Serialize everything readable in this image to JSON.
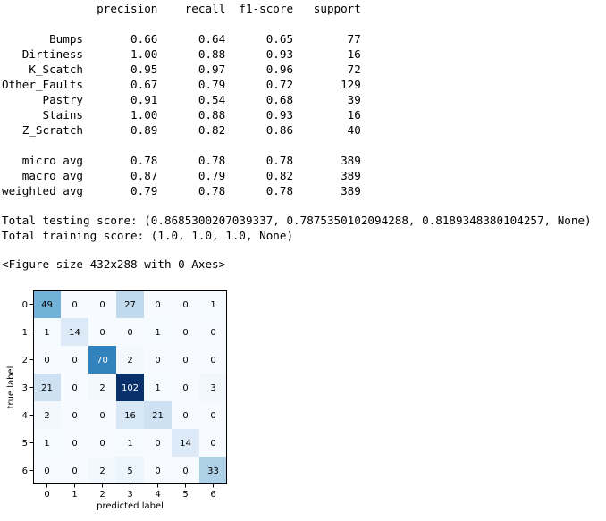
{
  "report": {
    "header": "              precision    recall  f1-score   support",
    "rows": [
      "",
      "       Bumps       0.66      0.64      0.65        77",
      "   Dirtiness       1.00      0.88      0.93        16",
      "    K_Scatch       0.95      0.97      0.96        72",
      "Other_Faults       0.67      0.79      0.72       129",
      "      Pastry       0.91      0.54      0.68        39",
      "      Stains       1.00      0.88      0.93        16",
      "   Z_Scratch       0.89      0.82      0.86        40",
      "",
      "   micro avg       0.78      0.78      0.78       389",
      "   macro avg       0.87      0.79      0.82       389",
      "weighted avg       0.79      0.78      0.78       389"
    ]
  },
  "scores": {
    "testing": "Total testing score: (0.8685300207039337, 0.7875350102094288, 0.8189348380104257, None)",
    "training": "Total training score: (1.0, 1.0, 1.0, None)"
  },
  "figure_size": "<Figure size 432x288 with 0 Axes>",
  "chart_data": {
    "type": "heatmap",
    "xlabel": "predicted label",
    "ylabel": "true label",
    "x_ticks": [
      "0",
      "1",
      "2",
      "3",
      "4",
      "5",
      "6"
    ],
    "y_ticks": [
      "0",
      "1",
      "2",
      "3",
      "4",
      "5",
      "6"
    ],
    "colormap": "Blues",
    "vmin": 0,
    "vmax": 102,
    "matrix": [
      [
        49,
        0,
        0,
        27,
        0,
        0,
        1
      ],
      [
        1,
        14,
        0,
        0,
        1,
        0,
        0
      ],
      [
        0,
        0,
        70,
        2,
        0,
        0,
        0
      ],
      [
        21,
        0,
        2,
        102,
        1,
        0,
        3
      ],
      [
        2,
        0,
        0,
        16,
        21,
        0,
        0
      ],
      [
        1,
        0,
        0,
        1,
        0,
        14,
        0
      ],
      [
        0,
        0,
        2,
        5,
        0,
        0,
        33
      ]
    ]
  }
}
